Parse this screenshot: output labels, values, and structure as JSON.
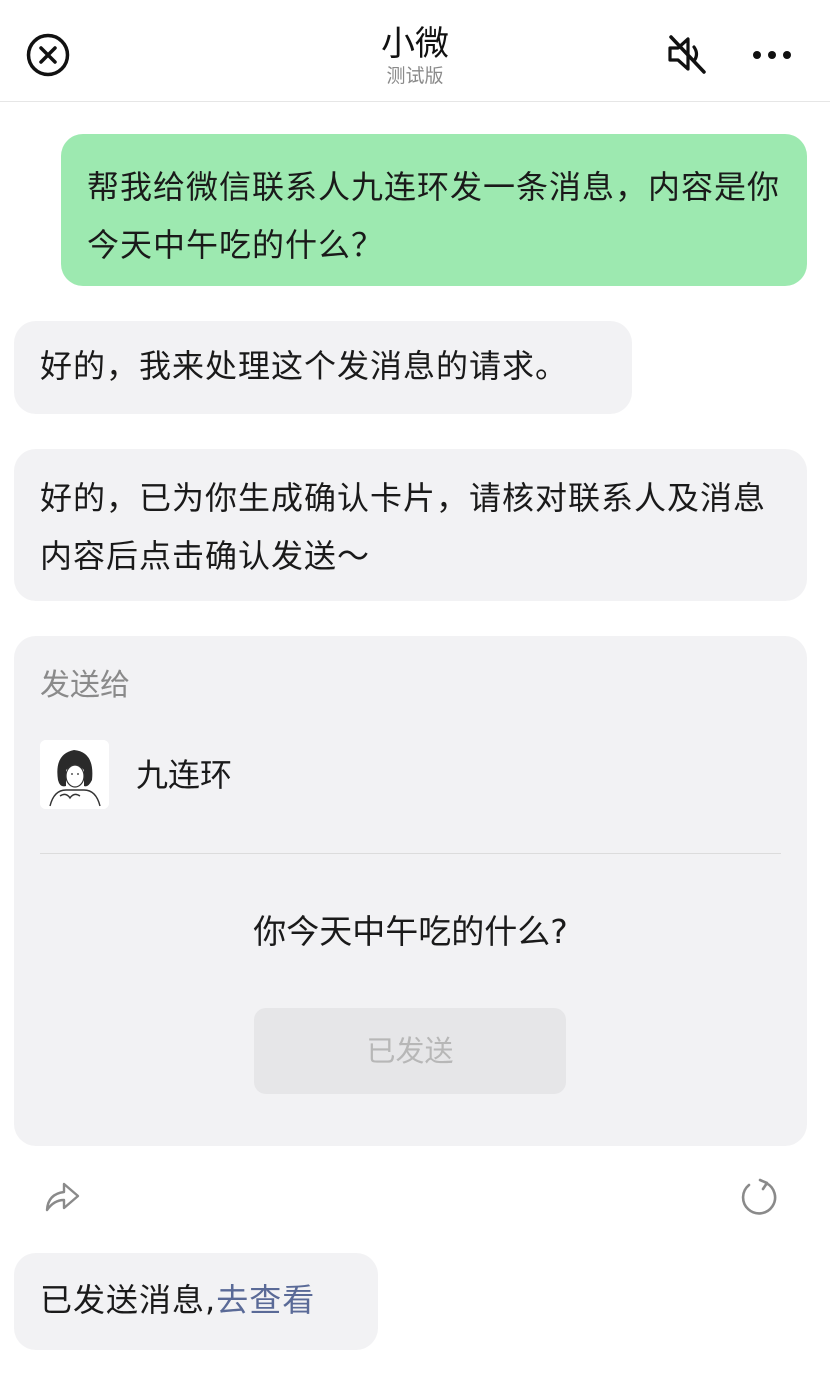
{
  "header": {
    "title": "小微",
    "subtitle": "测试版",
    "close_icon": "close-circle-icon",
    "mute_icon": "speaker-muted-icon",
    "more_icon": "more-dots-icon"
  },
  "messages": {
    "user_request": "帮我给微信联系人九连环发一条消息，内容是你今天中午吃的什么？",
    "bot_ack": "好的，我来处理这个发消息的请求。",
    "bot_confirm": "好的，已为你生成确认卡片，请核对联系人及消息内容后点击确认发送～"
  },
  "card": {
    "label": "发送给",
    "contact_name": "九连环",
    "message": "你今天中午吃的什么?",
    "button_label": "已发送"
  },
  "actions": {
    "share_icon": "share-forward-icon",
    "refresh_icon": "refresh-icon"
  },
  "result": {
    "text": "已发送消息,",
    "link": "去查看"
  },
  "colors": {
    "user_bubble": "#9de9b0",
    "bot_bubble": "#f2f2f4",
    "link": "#5a6a97",
    "disabled_text": "#b7b7b7"
  }
}
